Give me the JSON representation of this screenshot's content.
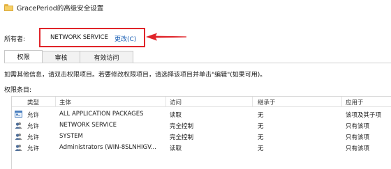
{
  "window": {
    "title": "GracePeriod的高级安全设置"
  },
  "owner": {
    "label": "所有者:",
    "name": "NETWORK SERVICE",
    "change_link": "更改(C)"
  },
  "tabs": [
    {
      "label": "权限",
      "active": true
    },
    {
      "label": "审核",
      "active": false
    },
    {
      "label": "有效访问",
      "active": false
    }
  ],
  "info_text": "如需其他信息，请双击权限项目。若要修改权限项目，请选择该项目并单击\"编辑\"(如果可用)。",
  "entries_label": "权限条目:",
  "table": {
    "headers": {
      "type": "类型",
      "principal": "主体",
      "access": "访问",
      "inherited": "继承于",
      "applies": "应用于"
    },
    "rows": [
      {
        "icon": "app-packages-icon",
        "type": "允许",
        "principal": "ALL APPLICATION PACKAGES",
        "access": "读取",
        "inherited": "无",
        "applies": "该项及其子项"
      },
      {
        "icon": "users-icon",
        "type": "允许",
        "principal": "NETWORK SERVICE",
        "access": "完全控制",
        "inherited": "无",
        "applies": "只有该项"
      },
      {
        "icon": "users-icon",
        "type": "允许",
        "principal": "SYSTEM",
        "access": "完全控制",
        "inherited": "无",
        "applies": "只有该项"
      },
      {
        "icon": "users-icon",
        "type": "允许",
        "principal": "Administrators (WIN-8SLNHIGV...",
        "access": "读取",
        "inherited": "无",
        "applies": "只有该项"
      }
    ]
  },
  "colors": {
    "highlight": "#e0242a",
    "link": "#1a5fb4"
  }
}
